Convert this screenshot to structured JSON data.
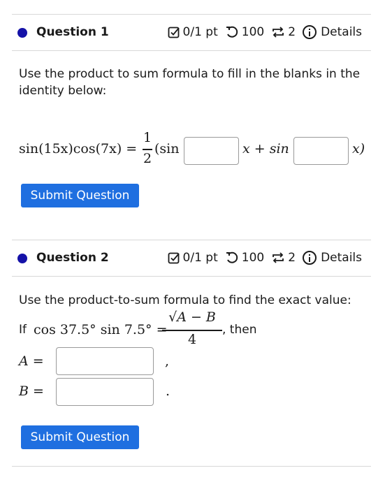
{
  "q1": {
    "title": "Question 1",
    "score": "0/1 pt",
    "attempts": "100",
    "retries": "2",
    "details": "Details",
    "prompt": "Use the product to sum formula to fill in the blanks in the identity below:",
    "lhs": "sin(15x)cos(7x) =",
    "frac_num": "1",
    "frac_den": "2",
    "term1": "(sin",
    "mid": "x + sin",
    "end": "x)",
    "submit_label": "Submit Question"
  },
  "q2": {
    "title": "Question 2",
    "score": "0/1 pt",
    "attempts": "100",
    "retries": "2",
    "details": "Details",
    "prompt": "Use the product-to-sum formula to find the exact value:",
    "if_text": "If",
    "expr": "cos 37.5° sin 7.5° =",
    "frac_num": "√A − B",
    "frac_den": "4",
    "then_text": ", then",
    "label_a": "A =",
    "label_b": "B =",
    "comma": ",",
    "period": ".",
    "submit_label": "Submit Question"
  }
}
